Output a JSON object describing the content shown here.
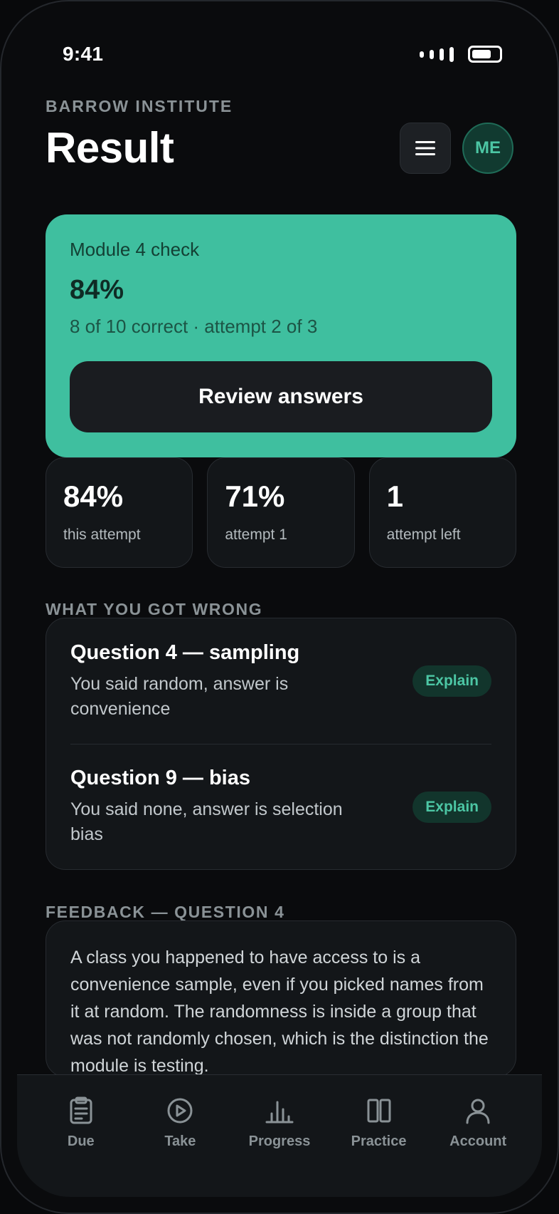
{
  "status_bar": {
    "time": "9:41"
  },
  "header": {
    "eyebrow": "BARROW INSTITUTE",
    "title": "Result",
    "avatar_initials": "ME"
  },
  "result_card": {
    "title": "Module 4 check",
    "score": "84%",
    "summary": "8 of 10 correct · attempt 2 of 3",
    "review_button": "Review answers"
  },
  "stats": [
    {
      "value": "84%",
      "label": "this attempt"
    },
    {
      "value": "71%",
      "label": "attempt 1"
    },
    {
      "value": "1",
      "label": "attempt left"
    }
  ],
  "wrong_section": {
    "label": "WHAT YOU GOT WRONG",
    "items": [
      {
        "title": "Question 4 — sampling",
        "detail": "You said random, answer is convenience",
        "action": "Explain"
      },
      {
        "title": "Question 9 — bias",
        "detail": "You said none, answer is selection bias",
        "action": "Explain"
      }
    ]
  },
  "feedback": {
    "label": "FEEDBACK — QUESTION 4",
    "text": "A class you happened to have access to is a convenience sample, even if you picked names from it at random. The randomness is inside a group that was not randomly chosen, which is the distinction the module is testing."
  },
  "tabs": [
    {
      "label": "Due",
      "icon": "clipboard-icon"
    },
    {
      "label": "Take",
      "icon": "play-circle-icon"
    },
    {
      "label": "Progress",
      "icon": "bar-chart-icon"
    },
    {
      "label": "Practice",
      "icon": "columns-icon"
    },
    {
      "label": "Account",
      "icon": "user-icon"
    }
  ],
  "colors": {
    "accent": "#3fbf9f",
    "background": "#0a0b0d",
    "card": "#131619"
  }
}
